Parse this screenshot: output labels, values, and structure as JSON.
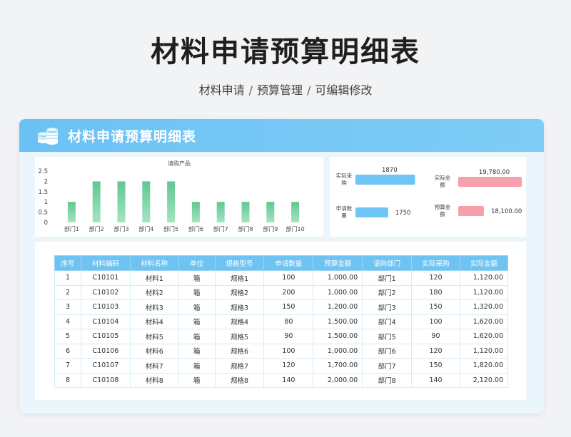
{
  "page": {
    "title": "材料申请预算明细表",
    "breadcrumb": [
      "材料申请",
      "预算管理",
      "可编辑修改"
    ]
  },
  "card": {
    "title": "材料申请预算明细表",
    "icon": "coin-stack-icon"
  },
  "chart_data": {
    "type": "bar",
    "title": "请购产品",
    "categories": [
      "部门1",
      "部门2",
      "部门3",
      "部门4",
      "部门5",
      "部门6",
      "部门7",
      "部门8",
      "部门9",
      "部门10"
    ],
    "values": [
      1,
      2,
      2,
      2,
      2,
      1,
      1,
      1,
      1,
      1
    ],
    "ylim": [
      0,
      2.5
    ],
    "yticks": [
      0,
      0.5,
      1,
      1.5,
      2,
      2.5
    ],
    "grid": false,
    "colors": {
      "bar": "#72cf9d"
    }
  },
  "kpis": [
    {
      "label": "实际采购",
      "value": "1870",
      "fraction": 0.95,
      "color": "#6ec4f5"
    },
    {
      "label": "申请数量",
      "value": "1750",
      "fraction": 0.52,
      "color": "#6ec4f5"
    },
    {
      "label": "实际金额",
      "value": "19,780.00",
      "fraction": 0.99,
      "color": "#f7a0ab"
    },
    {
      "label": "预算金额",
      "value": "18,100.00",
      "fraction": 0.4,
      "color": "#f7a0ab"
    }
  ],
  "table": {
    "headers": [
      "序号",
      "材料编码",
      "材料名称",
      "单位",
      "规格型号",
      "申请数量",
      "预算金额",
      "请购部门",
      "实际采购",
      "实际金额"
    ],
    "rows": [
      [
        "1",
        "C10101",
        "材料1",
        "箱",
        "规格1",
        "100",
        "1,000.00",
        "部门1",
        "120",
        "1,120.00"
      ],
      [
        "2",
        "C10102",
        "材料2",
        "箱",
        "规格2",
        "200",
        "1,000.00",
        "部门2",
        "180",
        "1,120.00"
      ],
      [
        "3",
        "C10103",
        "材料3",
        "箱",
        "规格3",
        "150",
        "1,200.00",
        "部门3",
        "150",
        "1,320.00"
      ],
      [
        "4",
        "C10104",
        "材料4",
        "箱",
        "规格4",
        "80",
        "1,500.00",
        "部门4",
        "100",
        "1,620.00"
      ],
      [
        "5",
        "C10105",
        "材料5",
        "箱",
        "规格5",
        "90",
        "1,500.00",
        "部门5",
        "90",
        "1,620.00"
      ],
      [
        "6",
        "C10106",
        "材料6",
        "箱",
        "规格6",
        "100",
        "1,000.00",
        "部门6",
        "120",
        "1,120.00"
      ],
      [
        "7",
        "C10107",
        "材料7",
        "箱",
        "规格7",
        "120",
        "1,700.00",
        "部门7",
        "150",
        "1,820.00"
      ],
      [
        "8",
        "C10108",
        "材料8",
        "箱",
        "规格8",
        "140",
        "2,000.00",
        "部门8",
        "140",
        "2,120.00"
      ]
    ]
  }
}
